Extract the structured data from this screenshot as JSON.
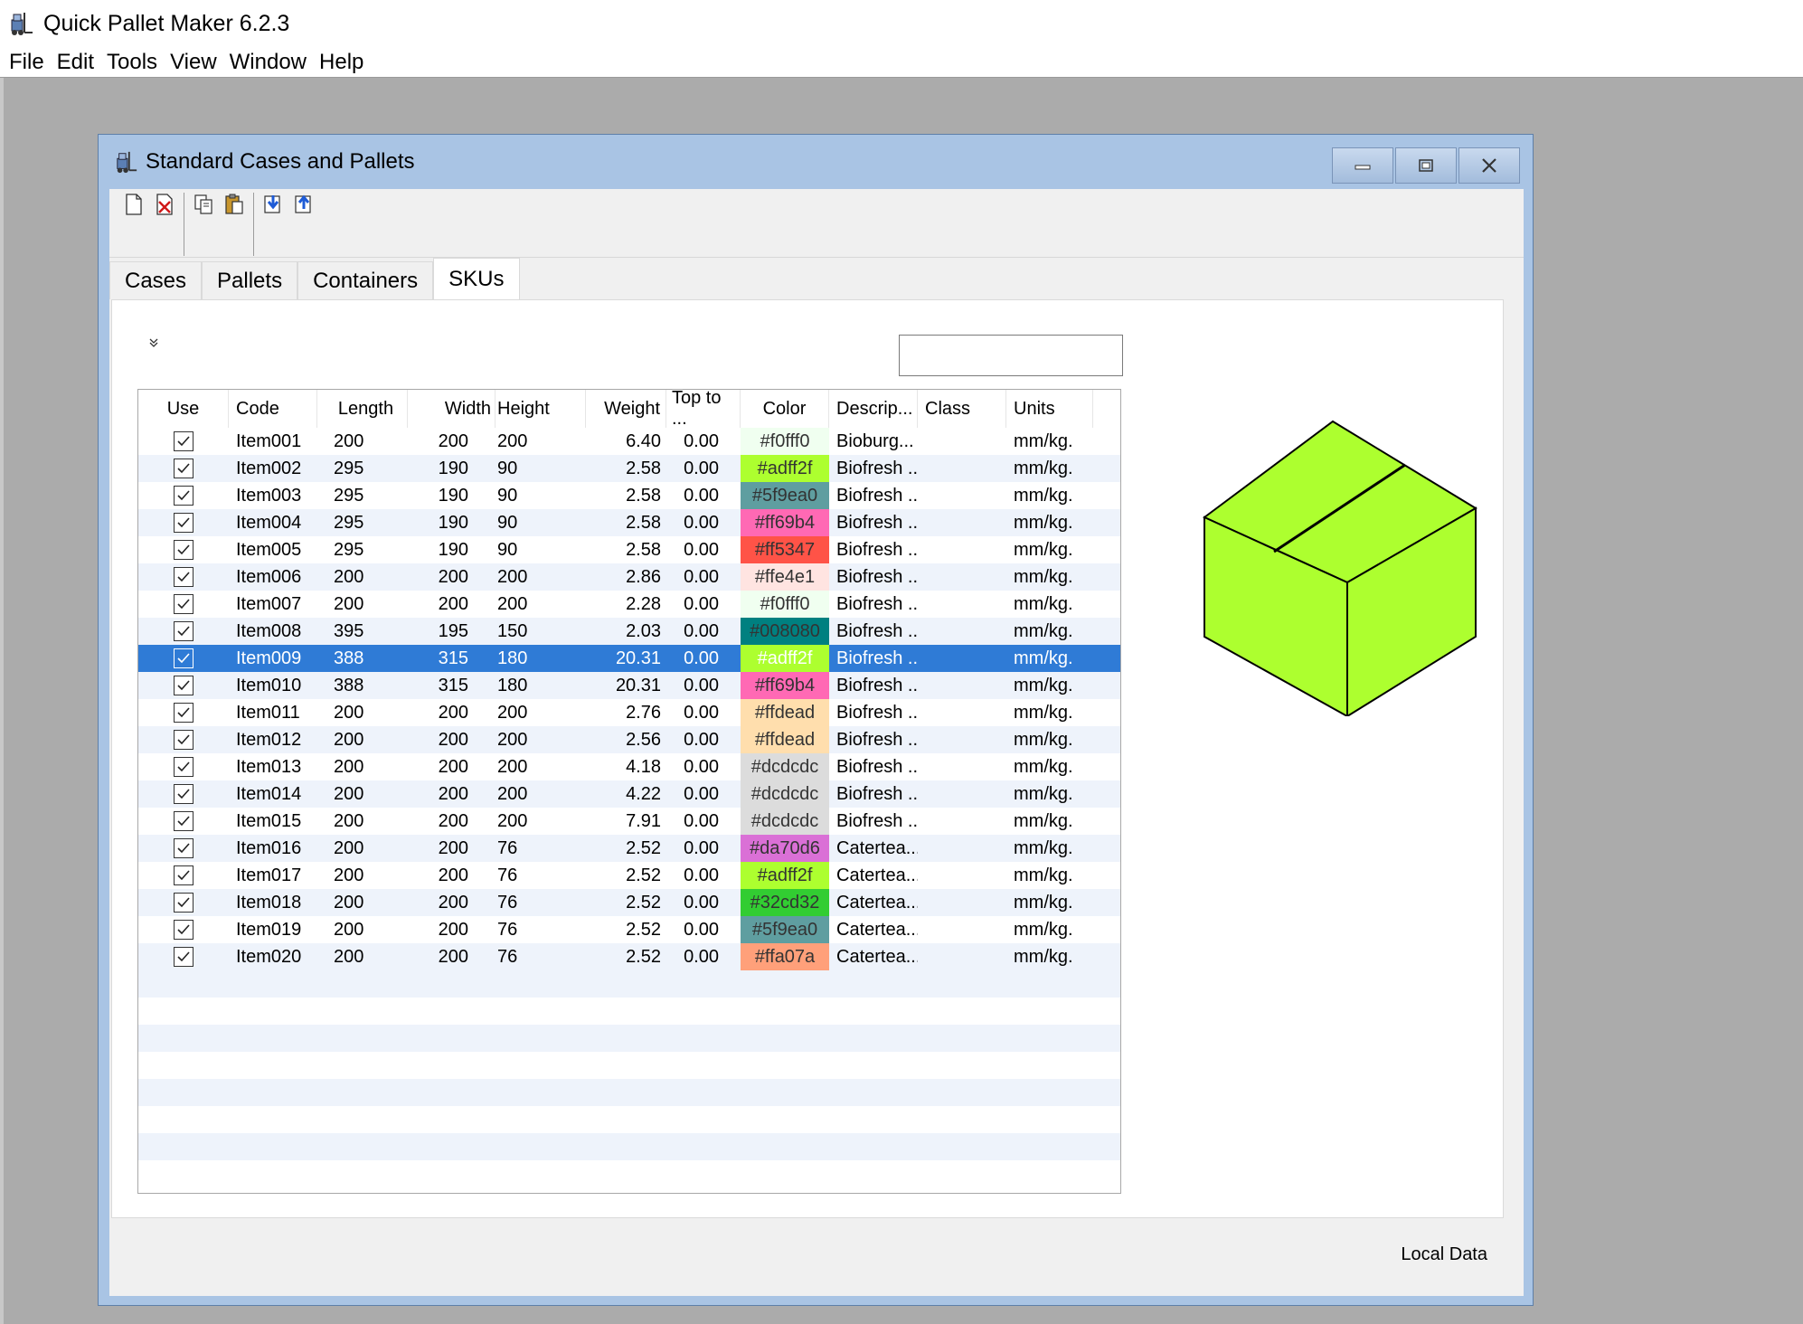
{
  "app": {
    "title": "Quick Pallet Maker 6.2.3",
    "menu": [
      "File",
      "Edit",
      "Tools",
      "View",
      "Window",
      "Help"
    ]
  },
  "dialog": {
    "title": "Standard Cases and Pallets",
    "tabs": [
      "Cases",
      "Pallets",
      "Containers",
      "SKUs"
    ],
    "active_tab": "SKUs",
    "filter_value": "",
    "status_text": "Local Data"
  },
  "grid": {
    "columns": [
      "Use",
      "Code",
      "Length",
      "Width",
      "Height",
      "Weight",
      "Top to ...",
      "Color",
      "Descrip...",
      "Class",
      "Units"
    ],
    "selected_index": 8,
    "rows": [
      {
        "code": "Item001",
        "length": "200",
        "width": "200",
        "height": "200",
        "weight": "6.40",
        "top": "0.00",
        "color": "#f0fff0",
        "desc": "Bioburg...",
        "class": "",
        "units": "mm/kg."
      },
      {
        "code": "Item002",
        "length": "295",
        "width": "190",
        "height": "90",
        "weight": "2.58",
        "top": "0.00",
        "color": "#adff2f",
        "desc": "Biofresh ...",
        "class": "",
        "units": "mm/kg."
      },
      {
        "code": "Item003",
        "length": "295",
        "width": "190",
        "height": "90",
        "weight": "2.58",
        "top": "0.00",
        "color": "#5f9ea0",
        "desc": "Biofresh ...",
        "class": "",
        "units": "mm/kg."
      },
      {
        "code": "Item004",
        "length": "295",
        "width": "190",
        "height": "90",
        "weight": "2.58",
        "top": "0.00",
        "color": "#ff69b4",
        "desc": "Biofresh ...",
        "class": "",
        "units": "mm/kg."
      },
      {
        "code": "Item005",
        "length": "295",
        "width": "190",
        "height": "90",
        "weight": "2.58",
        "top": "0.00",
        "color": "#ff5347",
        "desc": "Biofresh ...",
        "class": "",
        "units": "mm/kg."
      },
      {
        "code": "Item006",
        "length": "200",
        "width": "200",
        "height": "200",
        "weight": "2.86",
        "top": "0.00",
        "color": "#ffe4e1",
        "desc": "Biofresh ...",
        "class": "",
        "units": "mm/kg."
      },
      {
        "code": "Item007",
        "length": "200",
        "width": "200",
        "height": "200",
        "weight": "2.28",
        "top": "0.00",
        "color": "#f0fff0",
        "desc": "Biofresh ...",
        "class": "",
        "units": "mm/kg."
      },
      {
        "code": "Item008",
        "length": "395",
        "width": "195",
        "height": "150",
        "weight": "2.03",
        "top": "0.00",
        "color": "#008080",
        "desc": "Biofresh ...",
        "class": "",
        "units": "mm/kg."
      },
      {
        "code": "Item009",
        "length": "388",
        "width": "315",
        "height": "180",
        "weight": "20.31",
        "top": "0.00",
        "color": "#adff2f",
        "desc": "Biofresh ...",
        "class": "",
        "units": "mm/kg."
      },
      {
        "code": "Item010",
        "length": "388",
        "width": "315",
        "height": "180",
        "weight": "20.31",
        "top": "0.00",
        "color": "#ff69b4",
        "desc": "Biofresh ...",
        "class": "",
        "units": "mm/kg."
      },
      {
        "code": "Item011",
        "length": "200",
        "width": "200",
        "height": "200",
        "weight": "2.76",
        "top": "0.00",
        "color": "#ffdead",
        "desc": "Biofresh ...",
        "class": "",
        "units": "mm/kg."
      },
      {
        "code": "Item012",
        "length": "200",
        "width": "200",
        "height": "200",
        "weight": "2.56",
        "top": "0.00",
        "color": "#ffdead",
        "desc": "Biofresh ...",
        "class": "",
        "units": "mm/kg."
      },
      {
        "code": "Item013",
        "length": "200",
        "width": "200",
        "height": "200",
        "weight": "4.18",
        "top": "0.00",
        "color": "#dcdcdc",
        "desc": "Biofresh ...",
        "class": "",
        "units": "mm/kg."
      },
      {
        "code": "Item014",
        "length": "200",
        "width": "200",
        "height": "200",
        "weight": "4.22",
        "top": "0.00",
        "color": "#dcdcdc",
        "desc": "Biofresh ...",
        "class": "",
        "units": "mm/kg."
      },
      {
        "code": "Item015",
        "length": "200",
        "width": "200",
        "height": "200",
        "weight": "7.91",
        "top": "0.00",
        "color": "#dcdcdc",
        "desc": "Biofresh ...",
        "class": "",
        "units": "mm/kg."
      },
      {
        "code": "Item016",
        "length": "200",
        "width": "200",
        "height": "76",
        "weight": "2.52",
        "top": "0.00",
        "color": "#da70d6",
        "desc": "Catertea...",
        "class": "",
        "units": "mm/kg."
      },
      {
        "code": "Item017",
        "length": "200",
        "width": "200",
        "height": "76",
        "weight": "2.52",
        "top": "0.00",
        "color": "#adff2f",
        "desc": "Catertea...",
        "class": "",
        "units": "mm/kg."
      },
      {
        "code": "Item018",
        "length": "200",
        "width": "200",
        "height": "76",
        "weight": "2.52",
        "top": "0.00",
        "color": "#32cd32",
        "desc": "Catertea...",
        "class": "",
        "units": "mm/kg."
      },
      {
        "code": "Item019",
        "length": "200",
        "width": "200",
        "height": "76",
        "weight": "2.52",
        "top": "0.00",
        "color": "#5f9ea0",
        "desc": "Catertea...",
        "class": "",
        "units": "mm/kg."
      },
      {
        "code": "Item020",
        "length": "200",
        "width": "200",
        "height": "76",
        "weight": "2.52",
        "top": "0.00",
        "color": "#ffa07a",
        "desc": "Catertea...",
        "class": "",
        "units": "mm/kg."
      }
    ]
  },
  "preview": {
    "box_color": "#adff2f"
  }
}
